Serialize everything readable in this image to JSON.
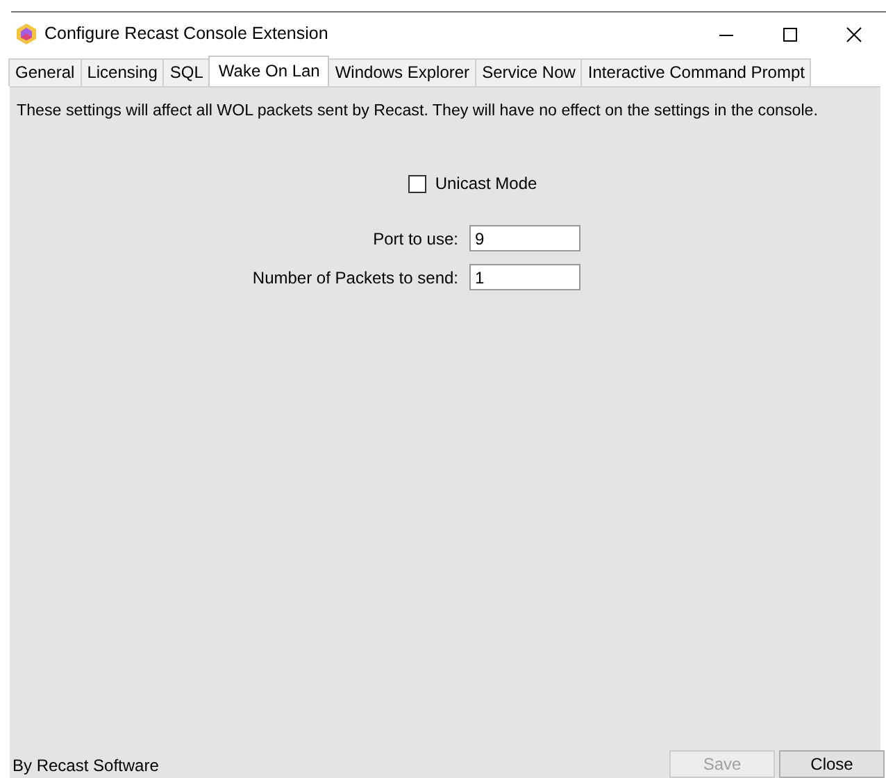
{
  "window": {
    "title": "Configure Recast Console Extension"
  },
  "tabs": [
    {
      "label": "General",
      "selected": false
    },
    {
      "label": "Licensing",
      "selected": false
    },
    {
      "label": "SQL",
      "selected": false
    },
    {
      "label": "Wake On Lan",
      "selected": true
    },
    {
      "label": "Windows Explorer",
      "selected": false
    },
    {
      "label": "Service Now",
      "selected": false
    },
    {
      "label": "Interactive Command Prompt",
      "selected": false
    }
  ],
  "description": "These settings will affect all WOL packets sent by Recast. They will have no effect on the settings in the console.",
  "unicast": {
    "label": "Unicast Mode",
    "checked": false
  },
  "fields": [
    {
      "label": "Port to use:",
      "value": "9"
    },
    {
      "label": "Number of Packets to send:",
      "value": "1"
    }
  ],
  "footer": "By Recast Software",
  "buttons": [
    {
      "label": "Save",
      "disabled": true
    },
    {
      "label": "Close",
      "disabled": false
    }
  ]
}
